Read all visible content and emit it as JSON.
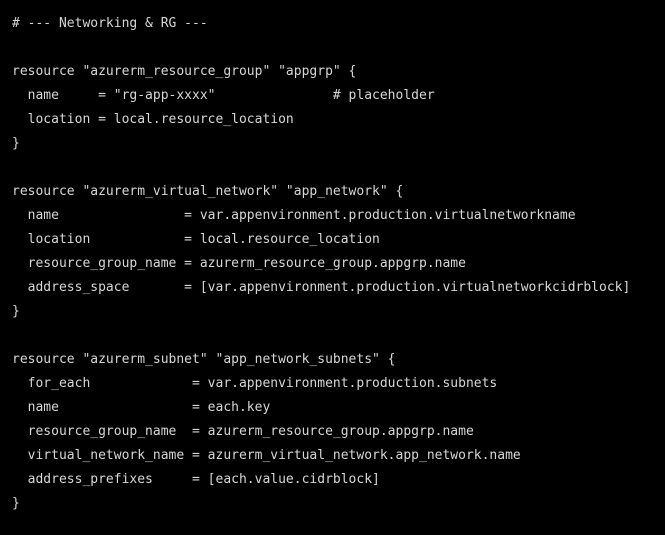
{
  "editor": {
    "background": "#000000",
    "text_color": "#d6d6d6",
    "lines": [
      "# --- Networking & RG ---",
      "",
      "resource \"azurerm_resource_group\" \"appgrp\" {",
      "  name     = \"rg-app-xxxx\"               # placeholder",
      "  location = local.resource_location",
      "}",
      "",
      "resource \"azurerm_virtual_network\" \"app_network\" {",
      "  name                = var.appenvironment.production.virtualnetworkname",
      "  location            = local.resource_location",
      "  resource_group_name = azurerm_resource_group.appgrp.name",
      "  address_space       = [var.appenvironment.production.virtualnetworkcidrblock]",
      "}",
      "",
      "resource \"azurerm_subnet\" \"app_network_subnets\" {",
      "  for_each             = var.appenvironment.production.subnets",
      "  name                 = each.key",
      "  resource_group_name  = azurerm_resource_group.appgrp.name",
      "  virtual_network_name = azurerm_virtual_network.app_network.name",
      "  address_prefixes     = [each.value.cidrblock]",
      "}"
    ]
  }
}
